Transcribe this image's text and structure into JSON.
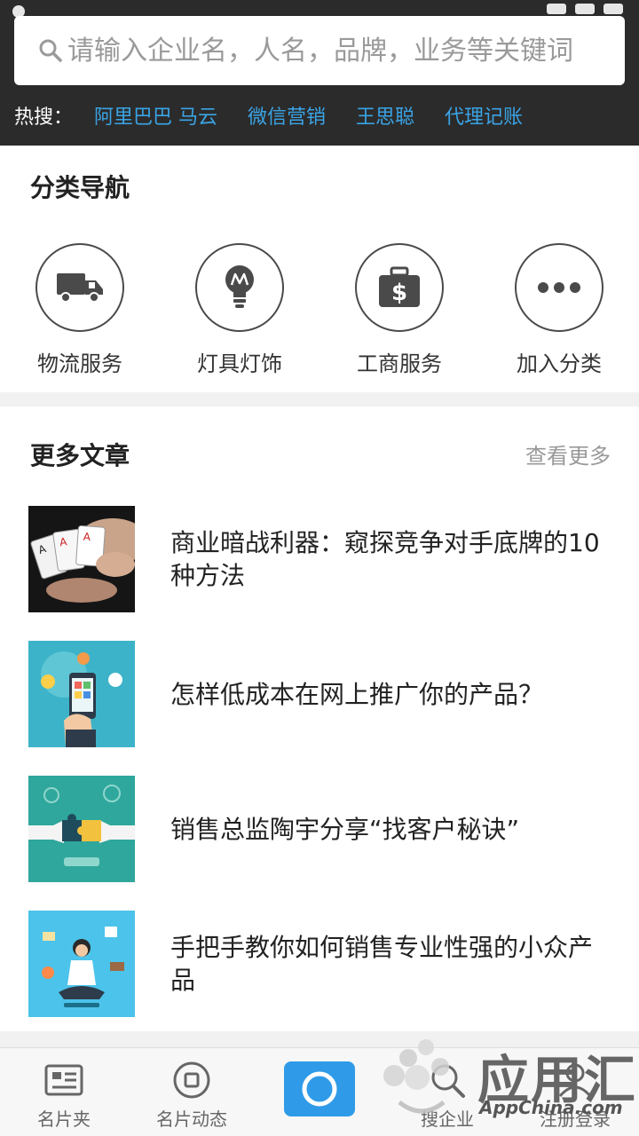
{
  "search": {
    "placeholder": "请输入企业名，人名，品牌，业务等关键词"
  },
  "hot": {
    "label": "热搜：",
    "items": [
      "阿里巴巴 马云",
      "微信营销",
      "王思聪",
      "代理记账"
    ]
  },
  "categories": {
    "title": "分类导航",
    "items": [
      {
        "label": "物流服务",
        "icon": "truck-icon"
      },
      {
        "label": "灯具灯饰",
        "icon": "lightbulb-icon"
      },
      {
        "label": "工商服务",
        "icon": "money-bag-icon"
      },
      {
        "label": "加入分类",
        "icon": "more-dots-icon"
      }
    ]
  },
  "articles": {
    "title": "更多文章",
    "more": "查看更多",
    "items": [
      {
        "title": "商业暗战利器：窥探竞争对手底牌的10种方法",
        "thumb": "playing-cards-photo"
      },
      {
        "title": "怎样低成本在网上推广你的产品？",
        "thumb": "phone-marketing-illustration"
      },
      {
        "title": "销售总监陶宇分享“找客户秘诀”",
        "thumb": "puzzle-handshake-illustration"
      },
      {
        "title": "手把手教你如何销售专业性强的小众产品",
        "thumb": "meditating-woman-illustration"
      }
    ]
  },
  "tabbar": {
    "items": [
      {
        "label": "名片夹",
        "icon": "card-holder-icon"
      },
      {
        "label": "名片动态",
        "icon": "card-feed-icon"
      },
      {
        "label": "",
        "icon": "camera-icon"
      },
      {
        "label": "搜企业",
        "icon": "search-company-icon"
      },
      {
        "label": "注册登录",
        "icon": "user-login-icon"
      }
    ]
  },
  "watermark": {
    "cn": "应用汇",
    "en": "AppChina.com"
  },
  "colors": {
    "header_bg": "#2b2b2b",
    "hot_link": "#3aa4e6",
    "camera_bg": "#2f9be8"
  }
}
